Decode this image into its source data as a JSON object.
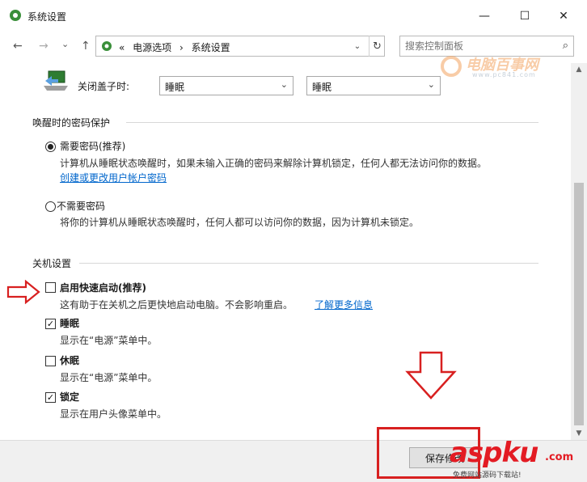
{
  "window": {
    "title": "系统设置",
    "minimize": "—",
    "maximize": "☐",
    "close": "✕"
  },
  "nav": {
    "back": "←",
    "forward": "→",
    "recent": "⌄",
    "up": "↑",
    "breadcrumb": [
      "«",
      "电源选项",
      "›",
      "系统设置"
    ],
    "dropdown": "⌄",
    "refresh": "↻",
    "search_placeholder": "搜索控制面板",
    "search_icon": "⌕"
  },
  "watermark_top": {
    "name": "电脑百事网",
    "url": "www.pc841.com"
  },
  "lid": {
    "label": "关闭盖子时:",
    "battery_value": "睡眠",
    "plugged_value": "睡眠"
  },
  "password_section": {
    "heading": "唤醒时的密码保护",
    "require": {
      "label": "需要密码(推荐)",
      "desc": "计算机从睡眠状态唤醒时，如果未输入正确的密码来解除计算机锁定，任何人都无法访问你的数",
      "desc2": "据。",
      "link": "创建或更改用户帐户密码",
      "selected": true
    },
    "not_require": {
      "label": "不需要密码",
      "desc": "将你的计算机从睡眠状态唤醒时，任何人都可以访问你的数据，因为计算机未锁定。",
      "selected": false
    }
  },
  "shutdown_section": {
    "heading": "关机设置",
    "items": [
      {
        "label": "启用快速启动(推荐)",
        "desc": "这有助于在关机之后更快地启动电脑。不会影响重启。",
        "link": "了解更多信息",
        "checked": false,
        "mark": ""
      },
      {
        "label": "睡眠",
        "desc": "显示在“电源”菜单中。",
        "checked": true,
        "mark": "✓"
      },
      {
        "label": "休眠",
        "desc": "显示在“电源”菜单中。",
        "checked": false,
        "mark": ""
      },
      {
        "label": "锁定",
        "desc": "显示在用户头像菜单中。",
        "checked": true,
        "mark": "✓"
      }
    ]
  },
  "footer": {
    "save_label": "保存修改"
  },
  "watermark_bottom": {
    "brand": "aspku",
    "tag": ".com",
    "slogan": "免费网站源码下载站!"
  },
  "colors": {
    "annotation_red": "#d82020",
    "link_blue": "#0066cc"
  }
}
